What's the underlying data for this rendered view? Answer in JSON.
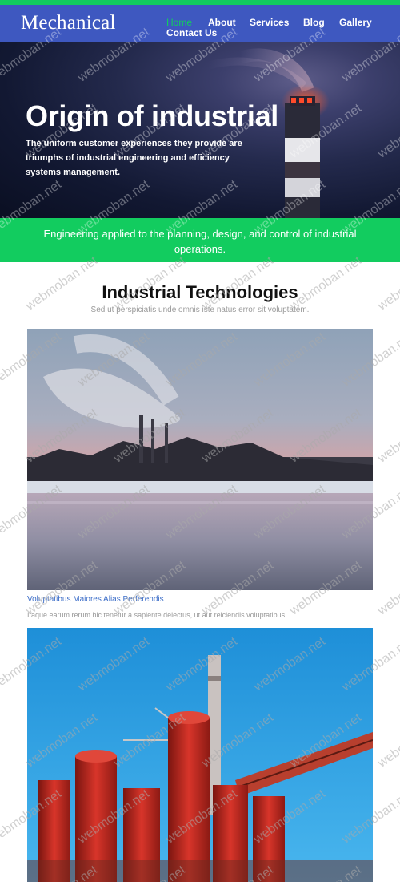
{
  "header": {
    "logo": "Mechanical",
    "nav": [
      {
        "label": "Home",
        "active": true
      },
      {
        "label": "About",
        "active": false
      },
      {
        "label": "Services",
        "active": false
      },
      {
        "label": "Blog",
        "active": false
      },
      {
        "label": "Gallery",
        "active": false
      },
      {
        "label": "Contact Us",
        "active": false
      }
    ]
  },
  "hero": {
    "title": "Origin of industrial",
    "description": "The uniform customer experiences they provide are triumphs of industrial engineering and efficiency systems management."
  },
  "banner": {
    "text": "Engineering applied to the planning, design, and control of industrial operations."
  },
  "technologies": {
    "title": "Industrial Technologies",
    "subtitle": "Sed ut perspiciatis unde omnis iste natus error sit voluptatem.",
    "cards": [
      {
        "title": "Voluptatibus Maiores Alias Perferendis",
        "description": "Itaque earum rerum hic tenetur a sapiente delectus, ut aut reiciendis voluptatibus"
      }
    ]
  },
  "watermark": "webmoban.net",
  "colors": {
    "accent_green": "#12cc5f",
    "header_blue": "#3e58c0",
    "link_blue": "#3e6fc9"
  }
}
